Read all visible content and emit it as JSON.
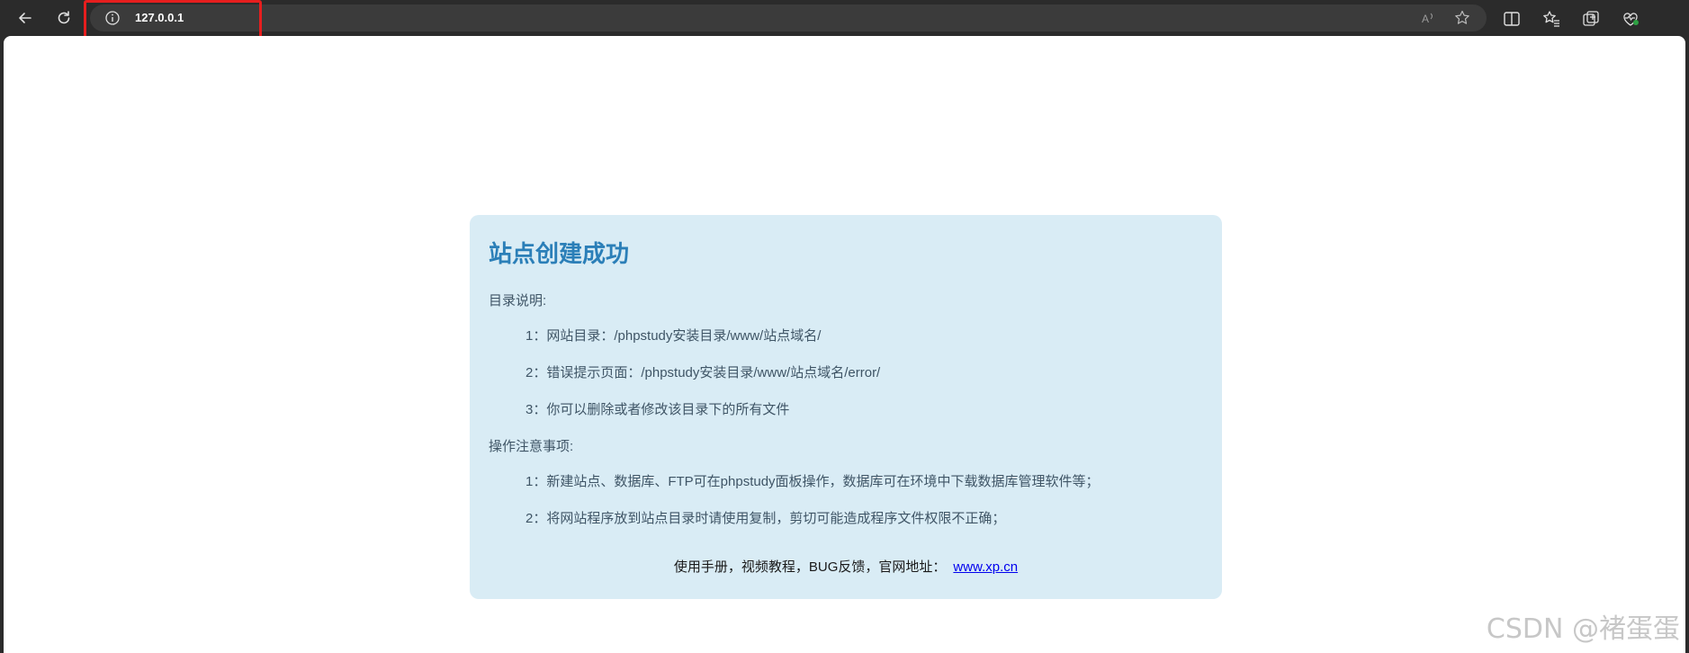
{
  "browser": {
    "url": "127.0.0.1",
    "icons": [
      "back-icon",
      "refresh-icon",
      "info-icon",
      "read-aloud-icon",
      "favorite-icon",
      "split-screen-icon",
      "favorites-icon",
      "collections-icon",
      "browser-essentials-icon"
    ]
  },
  "card": {
    "title": "站点创建成功",
    "directory_label": "目录说明:",
    "directory_items": [
      "1：网站目录：/phpstudy安装目录/www/站点域名/",
      "2：错误提示页面：/phpstudy安装目录/www/站点域名/error/",
      "3：你可以删除或者修改该目录下的所有文件"
    ],
    "notes_label": "操作注意事项:",
    "notes_items": [
      "1：新建站点、数据库、FTP可在phpstudy面板操作，数据库可在环境中下载数据库管理软件等；",
      "2：将网站程序放到站点目录时请使用复制，剪切可能造成程序文件权限不正确；"
    ],
    "footer_text": "使用手册，视频教程，BUG反馈，官网地址：",
    "footer_link": "www.xp.cn"
  },
  "watermark": "CSDN @褚蛋蛋",
  "colors": {
    "card_bg": "#d9ecf5",
    "title": "#2b7fb8",
    "highlight": "#e61e1e"
  }
}
